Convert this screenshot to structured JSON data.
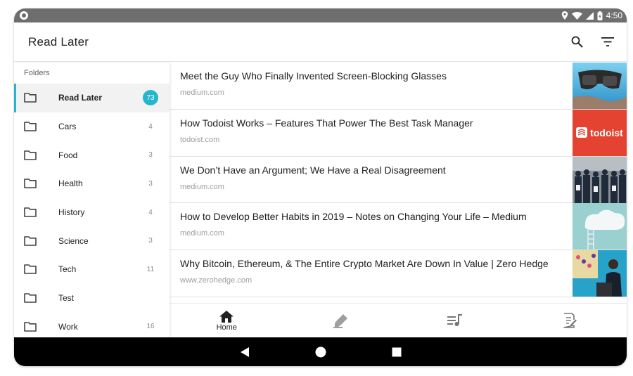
{
  "status_bar": {
    "time": "4:50"
  },
  "app_bar": {
    "title": "Read Later",
    "search_icon": "search-icon",
    "filter_icon": "filter-icon"
  },
  "sidebar": {
    "header": "Folders",
    "items": [
      {
        "label": "Read Later",
        "count": "73",
        "active": true
      },
      {
        "label": "Cars",
        "count": "4"
      },
      {
        "label": "Food",
        "count": "3"
      },
      {
        "label": "Health",
        "count": "3"
      },
      {
        "label": "History",
        "count": "4"
      },
      {
        "label": "Science",
        "count": "3"
      },
      {
        "label": "Tech",
        "count": "11"
      },
      {
        "label": "Test",
        "count": ""
      },
      {
        "label": "Work",
        "count": "16"
      }
    ]
  },
  "articles": [
    {
      "title": "Meet the Guy Who Finally Invented Screen-Blocking Glasses",
      "source": "medium.com"
    },
    {
      "title": "How Todoist Works – Features That Power The Best Task Manager",
      "source": "todoist.com",
      "thumb_text": "todoist"
    },
    {
      "title": "We Don’t Have an Argument; We Have a Real Disagreement",
      "source": "medium.com"
    },
    {
      "title": "How to Develop Better Habits in 2019 – Notes on Changing Your Life – Medium",
      "source": "medium.com"
    },
    {
      "title": "Why Bitcoin, Ethereum, & The Entire Crypto Market Are Down In Value | Zero Hedge",
      "source": "www.zerohedge.com"
    }
  ],
  "bottom_nav": [
    {
      "icon": "home-icon",
      "label": "Home",
      "active": true
    },
    {
      "icon": "highlighter-icon",
      "label": ""
    },
    {
      "icon": "playlist-audio-icon",
      "label": ""
    },
    {
      "icon": "notes-icon",
      "label": ""
    }
  ],
  "colors": {
    "accent": "#26b5cf",
    "status_bar": "#6e6e6e",
    "todoist_red": "#e44332"
  }
}
